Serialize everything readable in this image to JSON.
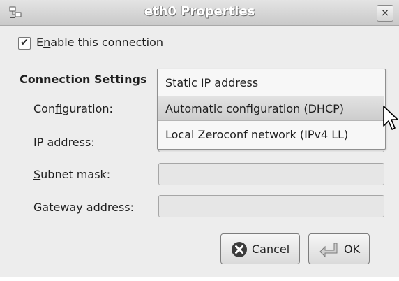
{
  "window": {
    "title": "eth0 Properties",
    "close_glyph": "×"
  },
  "connection": {
    "enable_checked": true,
    "enable_label_pre": "E",
    "enable_label_mnemonic": "n",
    "enable_label_post": "able this connection"
  },
  "settings": {
    "section_title": "Connection Settings",
    "configuration": {
      "pre": "Con",
      "mnemonic": "f",
      "post": "iguration:"
    },
    "ip_address": {
      "pre": "",
      "mnemonic": "I",
      "post": "P address:",
      "value": ""
    },
    "subnet_mask": {
      "pre": "",
      "mnemonic": "S",
      "post": "ubnet mask:",
      "value": ""
    },
    "gateway_address": {
      "pre": "",
      "mnemonic": "G",
      "post": "ateway address:",
      "value": ""
    }
  },
  "configuration_dropdown": {
    "options": [
      "Static IP address",
      "Automatic configuration (DHCP)",
      "Local Zeroconf network (IPv4 LL)"
    ],
    "highlighted": "Automatic configuration (DHCP)"
  },
  "buttons": {
    "cancel": {
      "mnemonic": "C",
      "rest": "ancel",
      "icon": "cancel-icon"
    },
    "ok": {
      "mnemonic": "O",
      "rest": "K",
      "icon": "ok-icon"
    }
  },
  "colors": {
    "window_bg": "#ededed",
    "highlight": "#d4d4d4",
    "cancel_icon": "#3c3c3c"
  }
}
